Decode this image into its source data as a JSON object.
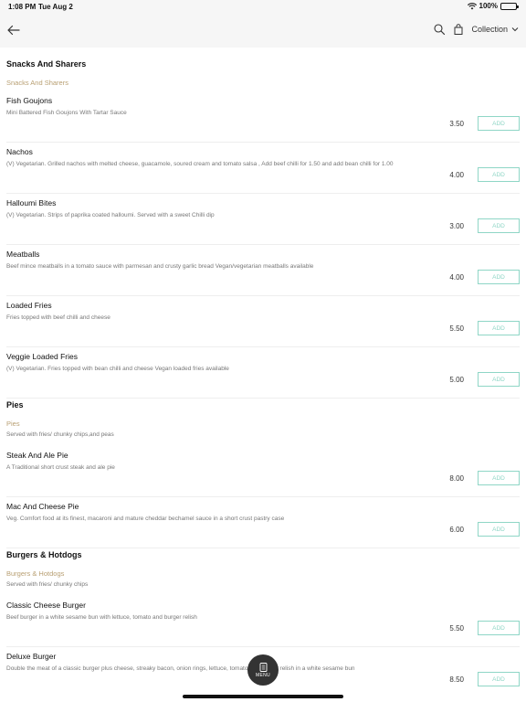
{
  "status_bar": {
    "time": "1:08 PM",
    "date": "Tue Aug 2",
    "battery": "100%"
  },
  "header": {
    "back_icon": "arrow-left-icon",
    "search_icon": "search-icon",
    "bag_icon": "shopping-bag-icon",
    "collection_label": "Collection"
  },
  "sections": [
    {
      "title": "Snacks And Sharers",
      "subtitle": "Snacks And Sharers",
      "description": "",
      "items": [
        {
          "name": "Fish Goujons",
          "desc": "Mini Battered Fish Goujons With Tartar Sauce",
          "price": "3.50",
          "add": "ADD"
        },
        {
          "name": "Nachos",
          "desc": "(V) Vegetarian. Grilled nachos with melted cheese, guacamole, soured cream and tomato salsa , Add beef chilli for 1.50 and add bean chilli for 1.00",
          "price": "4.00",
          "add": "ADD"
        },
        {
          "name": "Halloumi Bites",
          "desc": "(V)  Vegetarian. Strips of paprika coated halloumi. Served with a sweet Chilli dip",
          "price": "3.00",
          "add": "ADD"
        },
        {
          "name": "Meatballs",
          "desc": "Beef mince meatballs in a tomato sauce with parmesan and crusty garlic bread Vegan/vegetarian meatballs available",
          "price": "4.00",
          "add": "ADD"
        },
        {
          "name": "Loaded Fries",
          "desc": "Fries topped with beef chilli and cheese",
          "price": "5.50",
          "add": "ADD"
        },
        {
          "name": "Veggie Loaded Fries",
          "desc": "(V)  Vegetarian. Fries topped with bean chilli and cheese Vegan loaded fries available",
          "price": "5.00",
          "add": "ADD"
        }
      ]
    },
    {
      "title": "Pies",
      "subtitle": "Pies",
      "description": "Served with fries/ chunky chips,and peas",
      "items": [
        {
          "name": "Steak And Ale Pie",
          "desc": "A Traditional short crust steak and ale pie",
          "price": "8.00",
          "add": "ADD"
        },
        {
          "name": "Mac And Cheese Pie",
          "desc": "Veg. Comfort food at its finest, macaroni and mature cheddar bechamel sauce in a short crust pastry case",
          "price": "6.00",
          "add": "ADD"
        }
      ]
    },
    {
      "title": "Burgers & Hotdogs",
      "subtitle": "Burgers & Hotdogs",
      "description": "Served with fries/ chunky chips",
      "items": [
        {
          "name": "Classic Cheese Burger",
          "desc": "Beef burger in a white sesame bun with lettuce, tomato and burger relish",
          "price": "5.50",
          "add": "ADD"
        },
        {
          "name": "Deluxe Burger",
          "desc": "Double the meat of a classic burger plus cheese, streaky bacon, onion rings, lettuce, tomato and burger relish in a white sesame bun",
          "price": "8.50",
          "add": "ADD"
        }
      ]
    }
  ],
  "menu_button": {
    "label": "MENU",
    "icon": "menu-document-icon"
  },
  "colors": {
    "accent": "#8fd6c6",
    "subtitle": "#b89f72",
    "header_bg": "#f6f6f6",
    "fab": "#333333"
  }
}
